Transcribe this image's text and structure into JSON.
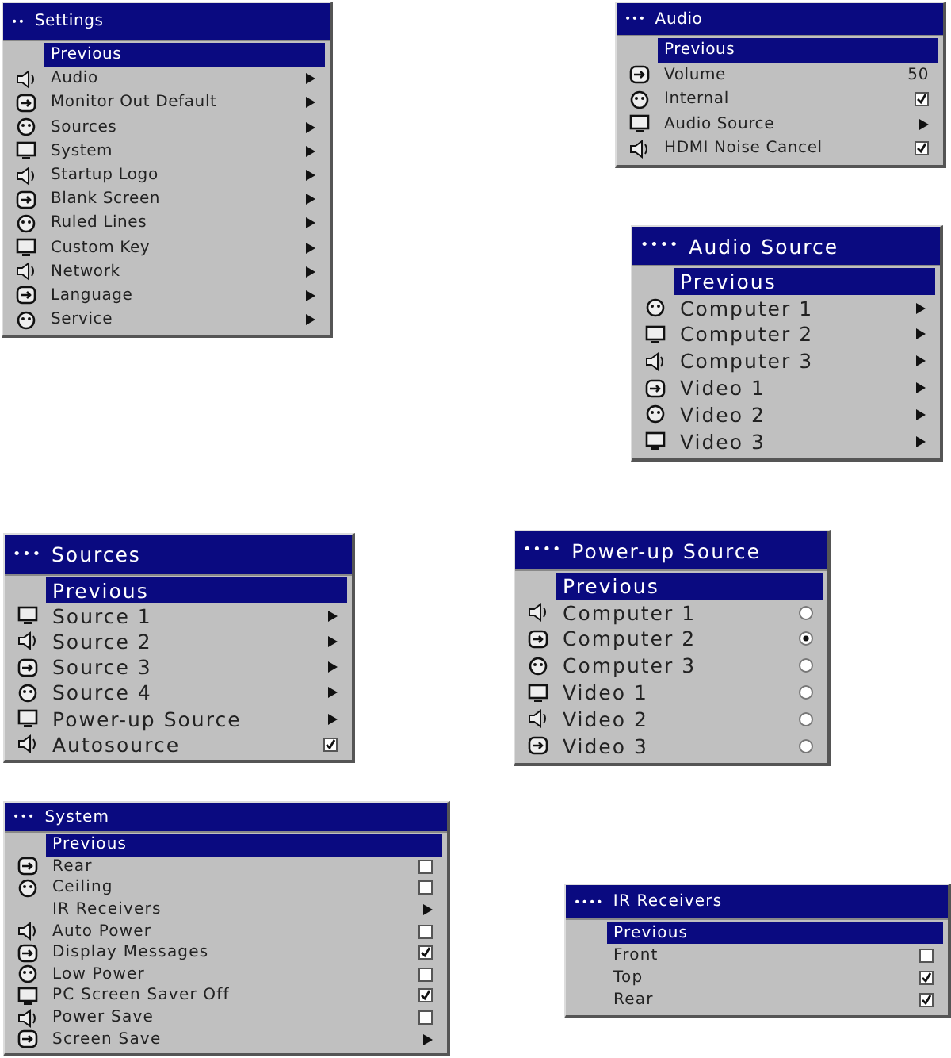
{
  "menus": [
    {
      "dots": "••",
      "title": "Settings",
      "items": [
        {
          "label": "Previous",
          "kind": "plain",
          "has_icon": false,
          "selected": true
        },
        {
          "label": "Audio",
          "kind": "submenu",
          "has_icon": true,
          "selected": false
        },
        {
          "label": "Monitor Out Default",
          "kind": "submenu",
          "has_icon": true,
          "selected": false
        },
        {
          "label": "Sources",
          "kind": "submenu",
          "has_icon": true,
          "selected": false
        },
        {
          "label": "System",
          "kind": "submenu",
          "has_icon": true,
          "selected": false
        },
        {
          "label": "Startup Logo",
          "kind": "submenu",
          "has_icon": true,
          "selected": false
        },
        {
          "label": "Blank Screen",
          "kind": "submenu",
          "has_icon": true,
          "selected": false
        },
        {
          "label": "Ruled Lines",
          "kind": "submenu",
          "has_icon": true,
          "selected": false
        },
        {
          "label": "Custom Key",
          "kind": "submenu",
          "has_icon": true,
          "selected": false
        },
        {
          "label": "Network",
          "kind": "submenu",
          "has_icon": true,
          "selected": false
        },
        {
          "label": "Language",
          "kind": "submenu",
          "has_icon": true,
          "selected": false
        },
        {
          "label": "Service",
          "kind": "submenu",
          "has_icon": true,
          "selected": false
        }
      ]
    },
    {
      "dots": "•••",
      "title": "Audio",
      "items": [
        {
          "label": "Previous",
          "kind": "plain",
          "has_icon": false,
          "selected": true
        },
        {
          "label": "Volume",
          "kind": "value",
          "value": "50",
          "has_icon": true,
          "selected": false
        },
        {
          "label": "Internal",
          "kind": "checkbox",
          "checked": true,
          "has_icon": true,
          "selected": false
        },
        {
          "label": "Audio Source",
          "kind": "submenu",
          "has_icon": true,
          "selected": false
        },
        {
          "label": "HDMI Noise Cancel",
          "kind": "checkbox",
          "checked": true,
          "has_icon": true,
          "selected": false
        }
      ]
    },
    {
      "dots": "••••",
      "title": "Audio Source",
      "items": [
        {
          "label": "Previous",
          "kind": "plain",
          "has_icon": false,
          "selected": true
        },
        {
          "label": "Computer 1",
          "kind": "submenu",
          "has_icon": true,
          "selected": false
        },
        {
          "label": "Computer 2",
          "kind": "submenu",
          "has_icon": true,
          "selected": false
        },
        {
          "label": "Computer 3",
          "kind": "submenu",
          "has_icon": true,
          "selected": false
        },
        {
          "label": "Video 1",
          "kind": "submenu",
          "has_icon": true,
          "selected": false
        },
        {
          "label": "Video 2",
          "kind": "submenu",
          "has_icon": true,
          "selected": false
        },
        {
          "label": "Video 3",
          "kind": "submenu",
          "has_icon": true,
          "selected": false
        }
      ]
    },
    {
      "dots": "•••",
      "title": "Sources",
      "items": [
        {
          "label": "Previous",
          "kind": "plain",
          "has_icon": false,
          "selected": true
        },
        {
          "label": "Source 1",
          "kind": "submenu",
          "has_icon": true,
          "selected": false
        },
        {
          "label": "Source 2",
          "kind": "submenu",
          "has_icon": true,
          "selected": false
        },
        {
          "label": "Source 3",
          "kind": "submenu",
          "has_icon": true,
          "selected": false
        },
        {
          "label": "Source 4",
          "kind": "submenu",
          "has_icon": true,
          "selected": false
        },
        {
          "label": "Power-up Source",
          "kind": "submenu",
          "has_icon": true,
          "selected": false
        },
        {
          "label": "Autosource",
          "kind": "checkbox",
          "checked": true,
          "has_icon": true,
          "selected": false
        }
      ]
    },
    {
      "dots": "••••",
      "title": "Power-up Source",
      "items": [
        {
          "label": "Previous",
          "kind": "plain",
          "has_icon": false,
          "selected": true
        },
        {
          "label": "Computer 1",
          "kind": "radio",
          "checked": false,
          "has_icon": true,
          "selected": false
        },
        {
          "label": "Computer 2",
          "kind": "radio",
          "checked": true,
          "has_icon": true,
          "selected": false
        },
        {
          "label": "Computer 3",
          "kind": "radio",
          "checked": false,
          "has_icon": true,
          "selected": false
        },
        {
          "label": "Video 1",
          "kind": "radio",
          "checked": false,
          "has_icon": true,
          "selected": false
        },
        {
          "label": "Video 2",
          "kind": "radio",
          "checked": false,
          "has_icon": true,
          "selected": false
        },
        {
          "label": "Video 3",
          "kind": "radio",
          "checked": false,
          "has_icon": true,
          "selected": false
        }
      ]
    },
    {
      "dots": "•••",
      "title": "System",
      "items": [
        {
          "label": "Previous",
          "kind": "plain",
          "has_icon": false,
          "selected": true
        },
        {
          "label": "Rear",
          "kind": "checkbox",
          "checked": false,
          "has_icon": true,
          "selected": false
        },
        {
          "label": "Ceiling",
          "kind": "checkbox",
          "checked": false,
          "has_icon": true,
          "selected": false
        },
        {
          "label": "IR Receivers",
          "kind": "submenu",
          "has_icon": false,
          "selected": false
        },
        {
          "label": "Auto Power",
          "kind": "checkbox",
          "checked": false,
          "has_icon": true,
          "selected": false
        },
        {
          "label": "Display Messages",
          "kind": "checkbox",
          "checked": true,
          "has_icon": true,
          "selected": false
        },
        {
          "label": "Low Power",
          "kind": "checkbox",
          "checked": false,
          "has_icon": true,
          "selected": false
        },
        {
          "label": "PC Screen Saver Off",
          "kind": "checkbox",
          "checked": true,
          "has_icon": true,
          "selected": false
        },
        {
          "label": "Power Save",
          "kind": "checkbox",
          "checked": false,
          "has_icon": true,
          "selected": false
        },
        {
          "label": "Screen Save",
          "kind": "submenu",
          "has_icon": true,
          "selected": false
        }
      ]
    },
    {
      "dots": "••••",
      "title": "IR Receivers",
      "items": [
        {
          "label": "Previous",
          "kind": "plain",
          "has_icon": false,
          "selected": true
        },
        {
          "label": "Front",
          "kind": "checkbox",
          "checked": false,
          "has_icon": false,
          "selected": false
        },
        {
          "label": "Top",
          "kind": "checkbox",
          "checked": true,
          "has_icon": false,
          "selected": false
        },
        {
          "label": "Rear",
          "kind": "checkbox",
          "checked": true,
          "has_icon": false,
          "selected": false
        }
      ]
    }
  ]
}
